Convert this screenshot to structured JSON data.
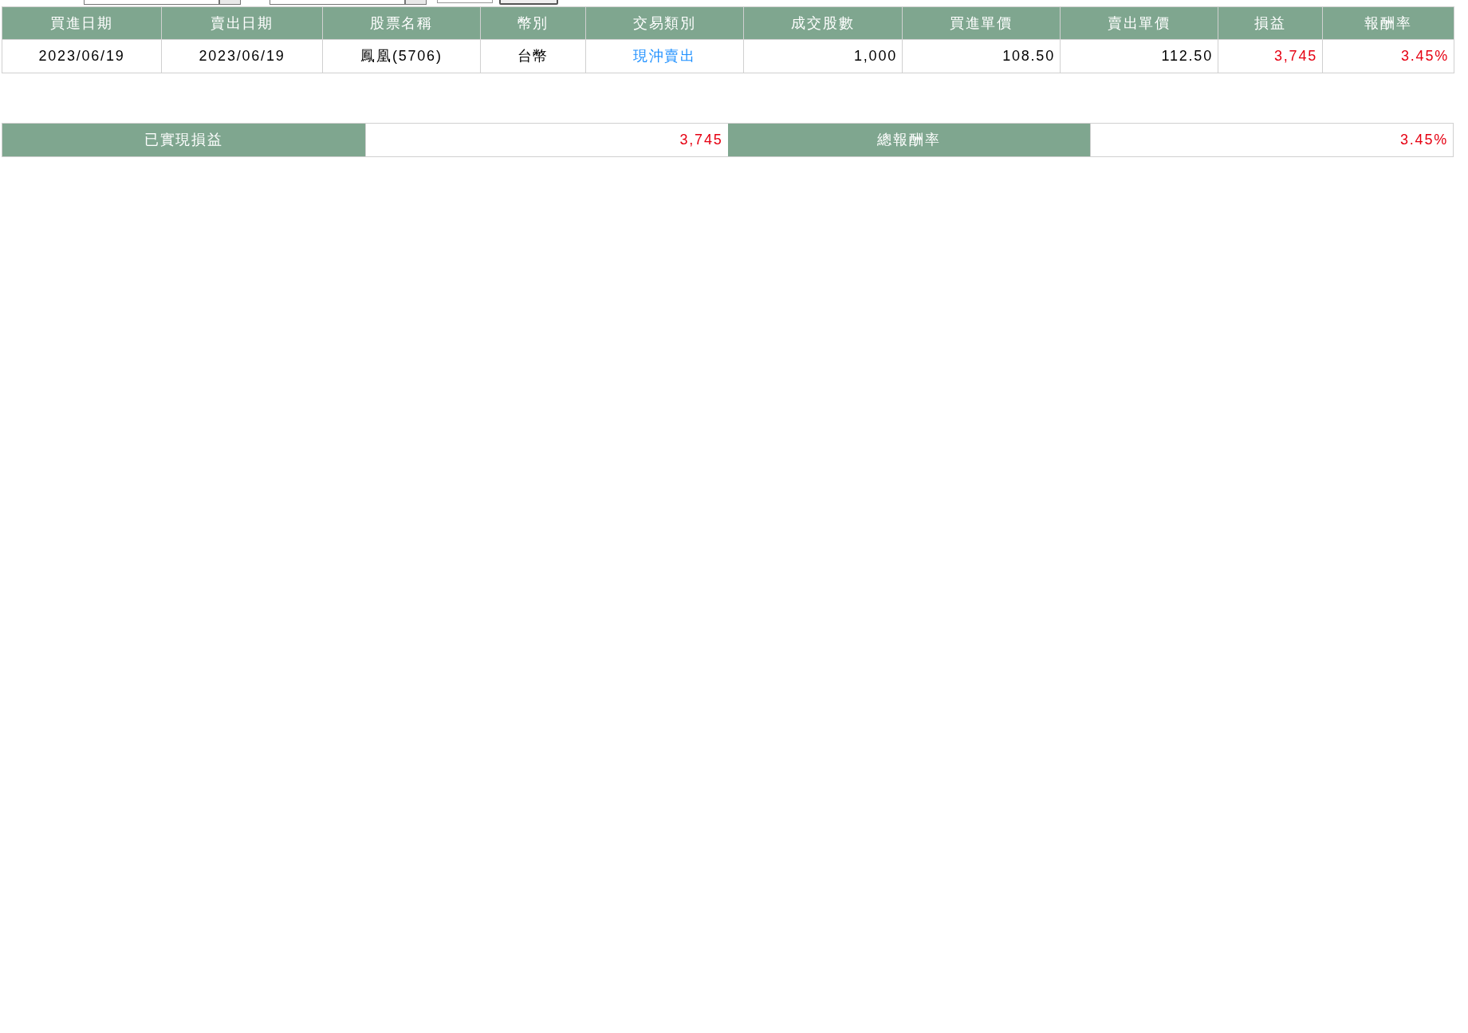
{
  "filter_bar": {
    "controls": [
      {
        "kind": "date-field"
      },
      {
        "kind": "dropdown-button"
      },
      {
        "kind": "date-field"
      },
      {
        "kind": "dropdown-button"
      },
      {
        "kind": "input"
      },
      {
        "kind": "button"
      }
    ]
  },
  "trades_table": {
    "columns": [
      "買進日期",
      "賣出日期",
      "股票名稱",
      "幣別",
      "交易類別",
      "成交股數",
      "買進單價",
      "賣出單價",
      "損益",
      "報酬率"
    ],
    "rows": [
      {
        "cells": [
          {
            "text": "2023/06/19",
            "kind": "center"
          },
          {
            "text": "2023/06/19",
            "kind": "center"
          },
          {
            "text": "鳳凰(5706)",
            "kind": "center"
          },
          {
            "text": "台幣",
            "kind": "center"
          },
          {
            "text": "現沖賣出",
            "kind": "link"
          },
          {
            "text": "1,000",
            "kind": "number"
          },
          {
            "text": "108.50",
            "kind": "number"
          },
          {
            "text": "112.50",
            "kind": "number"
          },
          {
            "text": "3,745",
            "kind": "profit"
          },
          {
            "text": "3.45%",
            "kind": "profit"
          }
        ]
      }
    ]
  },
  "summary": [
    {
      "label": "已實現損益",
      "value": "3,745"
    },
    {
      "label": "總報酬率",
      "value": "3.45%"
    }
  ]
}
